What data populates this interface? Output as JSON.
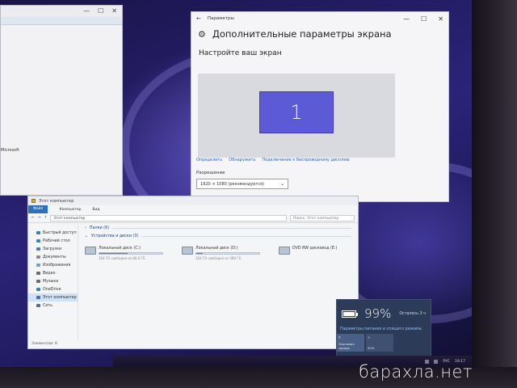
{
  "settings_window": {
    "titlebar_label": "Параметры",
    "page_title": "Дополнительные параметры экрана",
    "section_title": "Настройте ваш экран",
    "monitor_number": "1",
    "links": [
      "Определить",
      "Обнаружить",
      "Подключение к беспроводному дисплею"
    ],
    "resolution_label": "Разрешение",
    "resolution_value": "1920 × 1080 (рекомендуется)"
  },
  "explorer_window": {
    "titlebar_label": "Этот компьютер",
    "ribbon": {
      "file": "Файл",
      "computer": "Компьютер",
      "view": "Вид"
    },
    "address": "Этот компьютер",
    "search_placeholder": "Поиск: Этот компьютер",
    "nav_items": [
      {
        "label": "Быстрый доступ",
        "color": "#3a78c8"
      },
      {
        "label": "Рабочий стол",
        "color": "#3b7fd4"
      },
      {
        "label": "Загрузки",
        "color": "#3b7fd4"
      },
      {
        "label": "Документы",
        "color": "#8a8a9a"
      },
      {
        "label": "Изображения",
        "color": "#6aa0d8"
      },
      {
        "label": "Видео",
        "color": "#6a6a7a"
      },
      {
        "label": "Музыка",
        "color": "#6a6a7a"
      },
      {
        "label": "OneDrive",
        "color": "#2f7fd8"
      },
      {
        "label": "Этот компьютер",
        "color": "#4a6fa0"
      },
      {
        "label": "Сеть",
        "color": "#4a6fa0"
      }
    ],
    "selected_nav": "Этот компьютер",
    "group_folders": "Папки (6)",
    "group_drives": "Устройства и диски (3)",
    "drives": [
      {
        "name": "Локальный диск (C:)",
        "free": "164 ГБ свободно из 80,0 ГБ",
        "used_fraction": 0.45
      },
      {
        "name": "Локальный диск (D:)",
        "free": "164 ГБ свободно из 380 ГБ",
        "used_fraction": 0.1
      },
      {
        "name": "DVD RW дисковод (E:)",
        "free": "",
        "used_fraction": null
      }
    ],
    "status": "Элементов: 9"
  },
  "battery_flyout": {
    "percent": "99%",
    "percent_value": 0.99,
    "remaining": "Осталось 3 ч",
    "link": "Параметры питания и спящего режима",
    "tiles": [
      {
        "label": "Экономия заряда"
      },
      {
        "label": "40%"
      }
    ]
  },
  "taskbar": {
    "lang": "РУС",
    "time": "19:17"
  },
  "left_window": {
    "fragment": "Microsoft"
  },
  "watermark": "барахла.нет"
}
